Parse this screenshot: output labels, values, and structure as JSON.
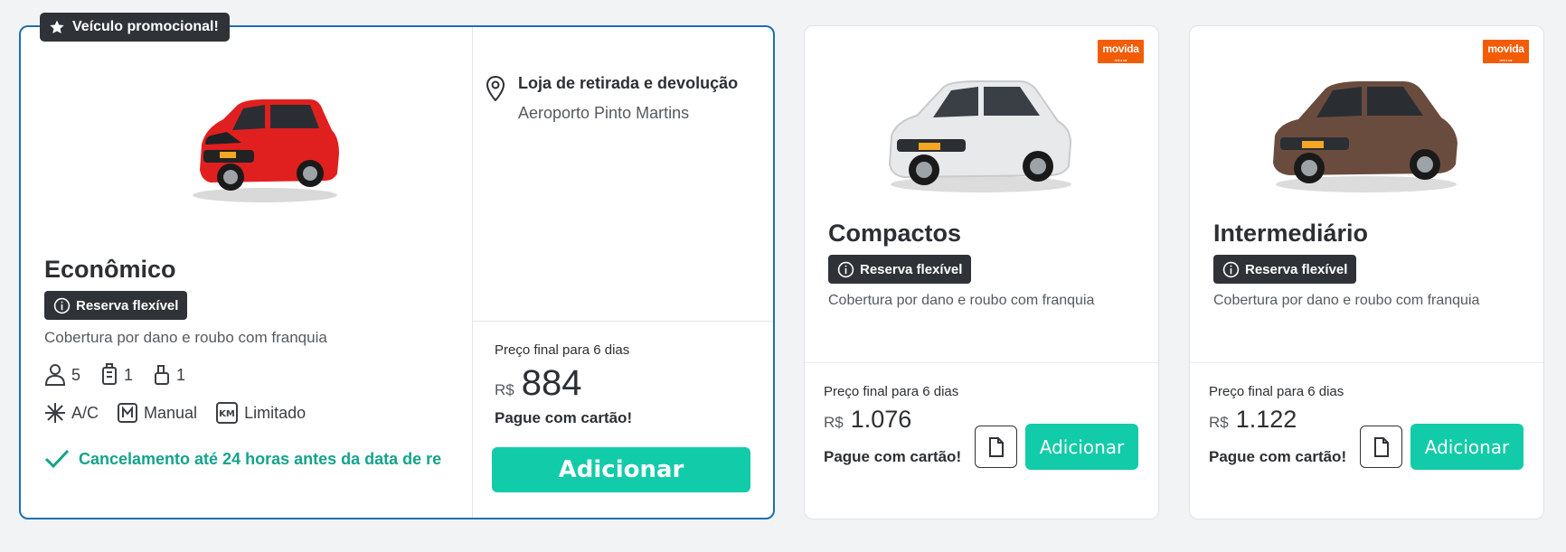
{
  "featured": {
    "promo_label": "Veículo promocional!",
    "category": "Econômico",
    "badge": "Reserva flexível",
    "coverage": "Cobertura por dano e roubo com franquia",
    "specs": {
      "seats": "5",
      "large_bags": "1",
      "small_bags": "1",
      "ac": "A/C",
      "transmission": "Manual",
      "mileage": "Limitado"
    },
    "cancellation": "Cancelamento até 24 horas antes da data de re",
    "location_title": "Loja de retirada e devolução",
    "location_name": "Aeroporto Pinto Martins",
    "price_label": "Preço final para 6 dias",
    "currency": "R$",
    "price": "884",
    "payment": "Pague com cartão!",
    "add_button": "Adicionar",
    "car_color": "#e0201f"
  },
  "cards": [
    {
      "category": "Compactos",
      "badge": "Reserva flexível",
      "coverage": "Cobertura por dano e roubo com franquia",
      "price_label": "Preço final para 6 dias",
      "currency": "R$",
      "price": "1.076",
      "payment": "Pague com cartão!",
      "add_button": "Adicionar",
      "brand_logo": "movida",
      "car_color": "#e8e9eb"
    },
    {
      "category": "Intermediário",
      "badge": "Reserva flexível",
      "coverage": "Cobertura por dano e roubo com franquia",
      "price_label": "Preço final para 6 dias",
      "currency": "R$",
      "price": "1.122",
      "payment": "Pague com cartão!",
      "add_button": "Adicionar",
      "brand_logo": "movida",
      "car_color": "#6a4c3e"
    }
  ],
  "colors": {
    "accent": "#12cba9",
    "featured_border": "#1f6fb2",
    "success_text": "#14a38b",
    "badge_bg": "#2f3237",
    "brand": "#f25c05"
  },
  "icons": [
    "star-icon",
    "info-icon",
    "person-icon",
    "luggage-icon",
    "bag-icon",
    "snowflake-icon",
    "manual-gear-icon",
    "km-icon",
    "check-icon",
    "location-pin-icon",
    "document-icon"
  ]
}
